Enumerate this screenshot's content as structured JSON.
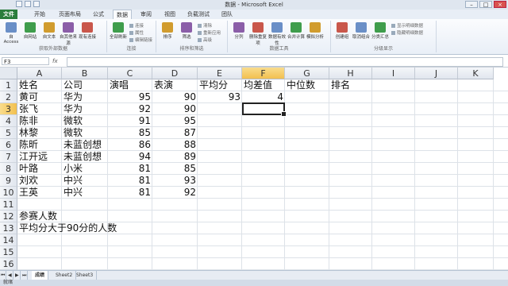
{
  "window": {
    "title": "数据 - Microsoft Excel"
  },
  "tabs": [
    "文件",
    "开始",
    "页面布局",
    "公式",
    "数据",
    "审阅",
    "视图",
    "负载测试",
    "团队"
  ],
  "active_tab": "数据",
  "ribbon": {
    "groups": [
      {
        "label": "获取外部数据",
        "buttons": [
          "自 Access",
          "自网站",
          "自文本",
          "自其他来源",
          "现有连接"
        ]
      },
      {
        "label": "连接",
        "buttons": [
          "全部刷新"
        ],
        "small": [
          "连接",
          "属性",
          "编辑链接"
        ]
      },
      {
        "label": "排序和筛选",
        "buttons": [
          "排序",
          "筛选"
        ],
        "small": [
          "清除",
          "重新应用",
          "高级"
        ]
      },
      {
        "label": "数据工具",
        "buttons": [
          "分列",
          "删除重复项",
          "数据有效性",
          "合并计算",
          "模拟分析"
        ]
      },
      {
        "label": "分级显示",
        "buttons": [
          "创建组",
          "取消组合",
          "分类汇总"
        ],
        "small": [
          "显示明细数据",
          "隐藏明细数据"
        ]
      }
    ]
  },
  "formula_bar": {
    "name_box": "F3",
    "fx": "fx",
    "content": ""
  },
  "columns": [
    "A",
    "B",
    "C",
    "D",
    "E",
    "F",
    "G",
    "H",
    "I",
    "J",
    "K"
  ],
  "rows": [
    "1",
    "2",
    "3",
    "4",
    "5",
    "6",
    "7",
    "8",
    "9",
    "10",
    "11",
    "12",
    "13",
    "14",
    "15",
    "16"
  ],
  "selected_cell": {
    "col": "F",
    "row": "3"
  },
  "table": {
    "headers": [
      "姓名",
      "公司",
      "演唱",
      "表演",
      "平均分",
      "均差值",
      "中位数",
      "排名"
    ],
    "rows": [
      [
        "黄可",
        "华为",
        "95",
        "90",
        "93",
        "4",
        "",
        ""
      ],
      [
        "张飞",
        "华为",
        "92",
        "90",
        "",
        "",
        "",
        ""
      ],
      [
        "陈非",
        "微软",
        "91",
        "95",
        "",
        "",
        "",
        ""
      ],
      [
        "林黎",
        "微软",
        "85",
        "87",
        "",
        "",
        "",
        ""
      ],
      [
        "陈昕",
        "未蓝创想",
        "86",
        "88",
        "",
        "",
        "",
        ""
      ],
      [
        "江开远",
        "未蓝创想",
        "94",
        "89",
        "",
        "",
        "",
        ""
      ],
      [
        "叶路",
        "小米",
        "81",
        "85",
        "",
        "",
        "",
        ""
      ],
      [
        "刘欢",
        "中兴",
        "81",
        "93",
        "",
        "",
        "",
        ""
      ],
      [
        "王英",
        "中兴",
        "81",
        "92",
        "",
        "",
        "",
        ""
      ]
    ]
  },
  "notes": [
    "参赛人数",
    "平均分大于90分的人数"
  ],
  "sheets": [
    "成绩",
    "Sheet2",
    "Sheet3"
  ],
  "active_sheet": "成绩",
  "status": "就绪"
}
